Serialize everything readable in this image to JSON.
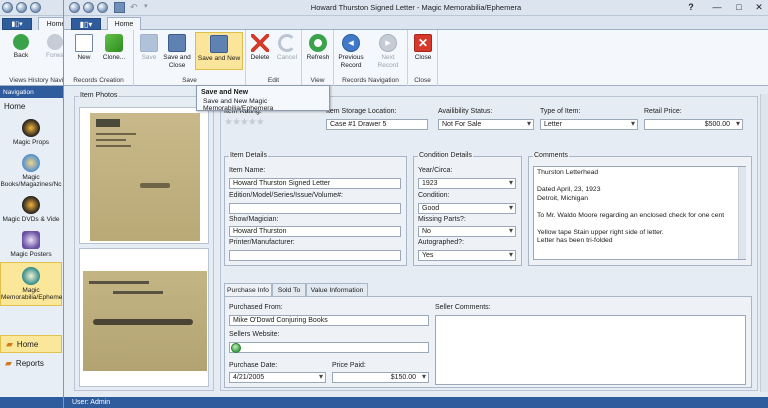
{
  "window": {
    "title": "Howard Thurston Signed Letter - Magic Memorabilia/Ephemera",
    "controls": {
      "help": "?",
      "minimize": "—",
      "maximize": "□",
      "close": "✕"
    }
  },
  "back_window": {
    "tab_home": "Home",
    "ribbon": {
      "back": "Back",
      "forward": "Forwa",
      "group_label": "Views History Navig"
    },
    "nav_header": "Navigation",
    "nav_home": "Home",
    "nav_items": [
      {
        "label": "Magic Props"
      },
      {
        "label": "Magic Books/Magazines/Nc"
      },
      {
        "label": "Magic DVDs & Vide"
      },
      {
        "label": "Magic Posters"
      },
      {
        "label": "Magic Memorabilia/Epheme"
      }
    ],
    "bottom_home": "Home",
    "bottom_reports": "Reports",
    "status_user": "User: Admin"
  },
  "tabs": {
    "file_icon": "▮▯▾",
    "home": "Home"
  },
  "ribbon": {
    "groups": {
      "records_creation": "Records Creation",
      "save": "Save",
      "edit": "Edit",
      "view": "View",
      "records_navigation": "Records Navigation",
      "close": "Close"
    },
    "buttons": {
      "new": "New",
      "clone": "Clone...",
      "save": "Save",
      "save_and_close": "Save and Close",
      "save_and_new": "Save and New",
      "delete": "Delete",
      "cancel": "Cancel",
      "refresh": "Refresh",
      "previous_record": "Previous Record",
      "next_record": "Next Record",
      "close": "Close"
    }
  },
  "tooltip": {
    "title": "Save and New",
    "body": "Save and New Magic Memorabilia/Ephemera"
  },
  "item_photos": {
    "label": "Item Photos"
  },
  "top_fields": {
    "item_rating_label": "Item Rating:",
    "stars": "★★★★★",
    "rating": 0,
    "storage_label": "Item Storage Location:",
    "storage_value": "Case #1 Drawer 5",
    "availability_label": "Availibility Status:",
    "availability_value": "Not For Sale",
    "type_label": "Type of Item:",
    "type_value": "Letter",
    "retail_label": "Retail Price:",
    "retail_value": "$500.00"
  },
  "item_details": {
    "title": "Item Details",
    "item_name_label": "Item Name:",
    "item_name_value": "Howard Thurston Signed Letter",
    "edition_label": "Edition/Model/Series/Issue/Volume#:",
    "edition_value": "",
    "show_label": "Show/Magician:",
    "show_value": "Howard Thurston",
    "printer_label": "Printer/Manufacturer:",
    "printer_value": ""
  },
  "condition_details": {
    "title": "Condition Details",
    "year_label": "Year/Circa:",
    "year_value": "1923",
    "condition_label": "Condition:",
    "condition_value": "Good",
    "missing_label": "Missing Parts?:",
    "missing_value": "No",
    "autographed_label": "Autographed?:",
    "autographed_value": "Yes"
  },
  "comments": {
    "title": "Comments",
    "text": "Thurston Letterhead\n\nDated April, 23, 1923\nDetroit, Michigan\n\nTo Mr. Waldo Moore regarding an enclosed check for one cent\n\nYellow tape Stain upper right side of letter.\nLetter has been tri-folded"
  },
  "purchase_tabs": [
    "Purchase Info",
    "Sold To",
    "Value Information"
  ],
  "purchase": {
    "from_label": "Purchased From:",
    "from_value": "Mike O'Dowd Conjuring Books",
    "website_label": "Sellers Website:",
    "website_value": "",
    "date_label": "Purchase Date:",
    "date_value": "4/21/2005",
    "price_label": "Price Paid:",
    "price_value": "$150.00",
    "seller_comments_label": "Seller Comments:",
    "seller_comments_value": ""
  },
  "status": {
    "user": "User: Admin"
  }
}
